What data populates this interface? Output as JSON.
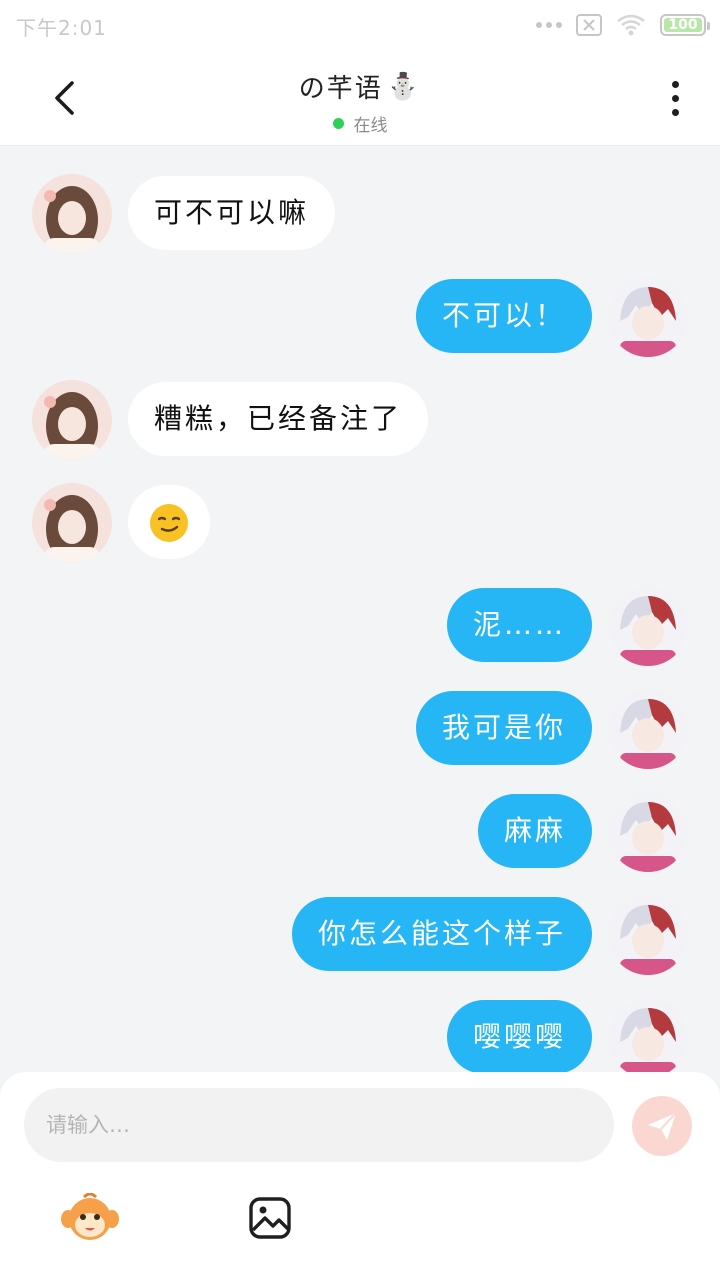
{
  "status_bar": {
    "time": "下午2:01",
    "battery": "100"
  },
  "header": {
    "contact_name": "の芊语",
    "contact_name_emoji": "⛄",
    "presence": "在线",
    "presence_color": "#2fcf5a"
  },
  "messages": [
    {
      "side": "left",
      "text": "可不可以嘛",
      "icon": ""
    },
    {
      "side": "right",
      "text": "不可以！",
      "icon": ""
    },
    {
      "side": "left",
      "text": "糟糕，已经备注了",
      "icon": ""
    },
    {
      "side": "left",
      "text": "",
      "icon": "smirk-emoji"
    },
    {
      "side": "right",
      "text": "泥……",
      "icon": ""
    },
    {
      "side": "right",
      "text": "我可是你",
      "icon": ""
    },
    {
      "side": "right",
      "text": "麻麻",
      "icon": ""
    },
    {
      "side": "right",
      "text": "你怎么能这个样子",
      "icon": ""
    },
    {
      "side": "right",
      "text": "嘤嘤嘤",
      "icon": ""
    }
  ],
  "composer": {
    "placeholder": "请输入…",
    "send_icon": "paper-plane-icon",
    "tools": [
      "mascot-sticker-icon",
      "image-icon"
    ]
  },
  "colors": {
    "sent_bubble": "#26b5f5",
    "received_bubble": "#ffffff",
    "background": "#f3f4f6",
    "send_button": "#fbd7d2"
  }
}
